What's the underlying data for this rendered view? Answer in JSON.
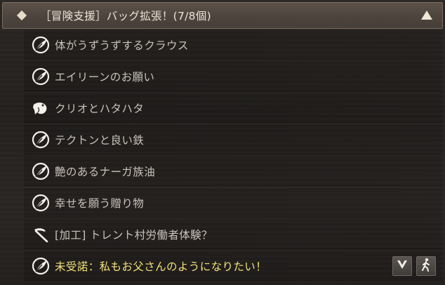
{
  "header": {
    "title": "［冒険支援］バッグ拡張！(7/8個)",
    "collapse_icon": "triangle-up-icon"
  },
  "quests": [
    {
      "label": "体がうずうずするクラウス",
      "icon": "quill-icon",
      "state": "normal"
    },
    {
      "label": "エイリーンのお願い",
      "icon": "quill-icon",
      "state": "normal"
    },
    {
      "label": "クリオとハタハタ",
      "icon": "fish-icon",
      "state": "normal"
    },
    {
      "label": "テクトンと良い鉄",
      "icon": "quill-icon",
      "state": "normal"
    },
    {
      "label": "艶のあるナーガ族油",
      "icon": "quill-icon",
      "state": "normal"
    },
    {
      "label": "幸せを願う贈り物",
      "icon": "quill-icon",
      "state": "normal"
    },
    {
      "label": "[加工] トレント村労働者体験？",
      "icon": "sickle-icon",
      "state": "normal"
    },
    {
      "label": "未受諾：私もお父さんのようになりたい！",
      "icon": "quill-icon",
      "state": "not-accepted"
    }
  ],
  "actions": {
    "expand_icon": "chevron-down-icon",
    "navigate_icon": "walking-person-icon"
  },
  "colors": {
    "header_bg": "#544a42",
    "text": "#c9c3bb",
    "highlight_text": "#f2e27a"
  }
}
